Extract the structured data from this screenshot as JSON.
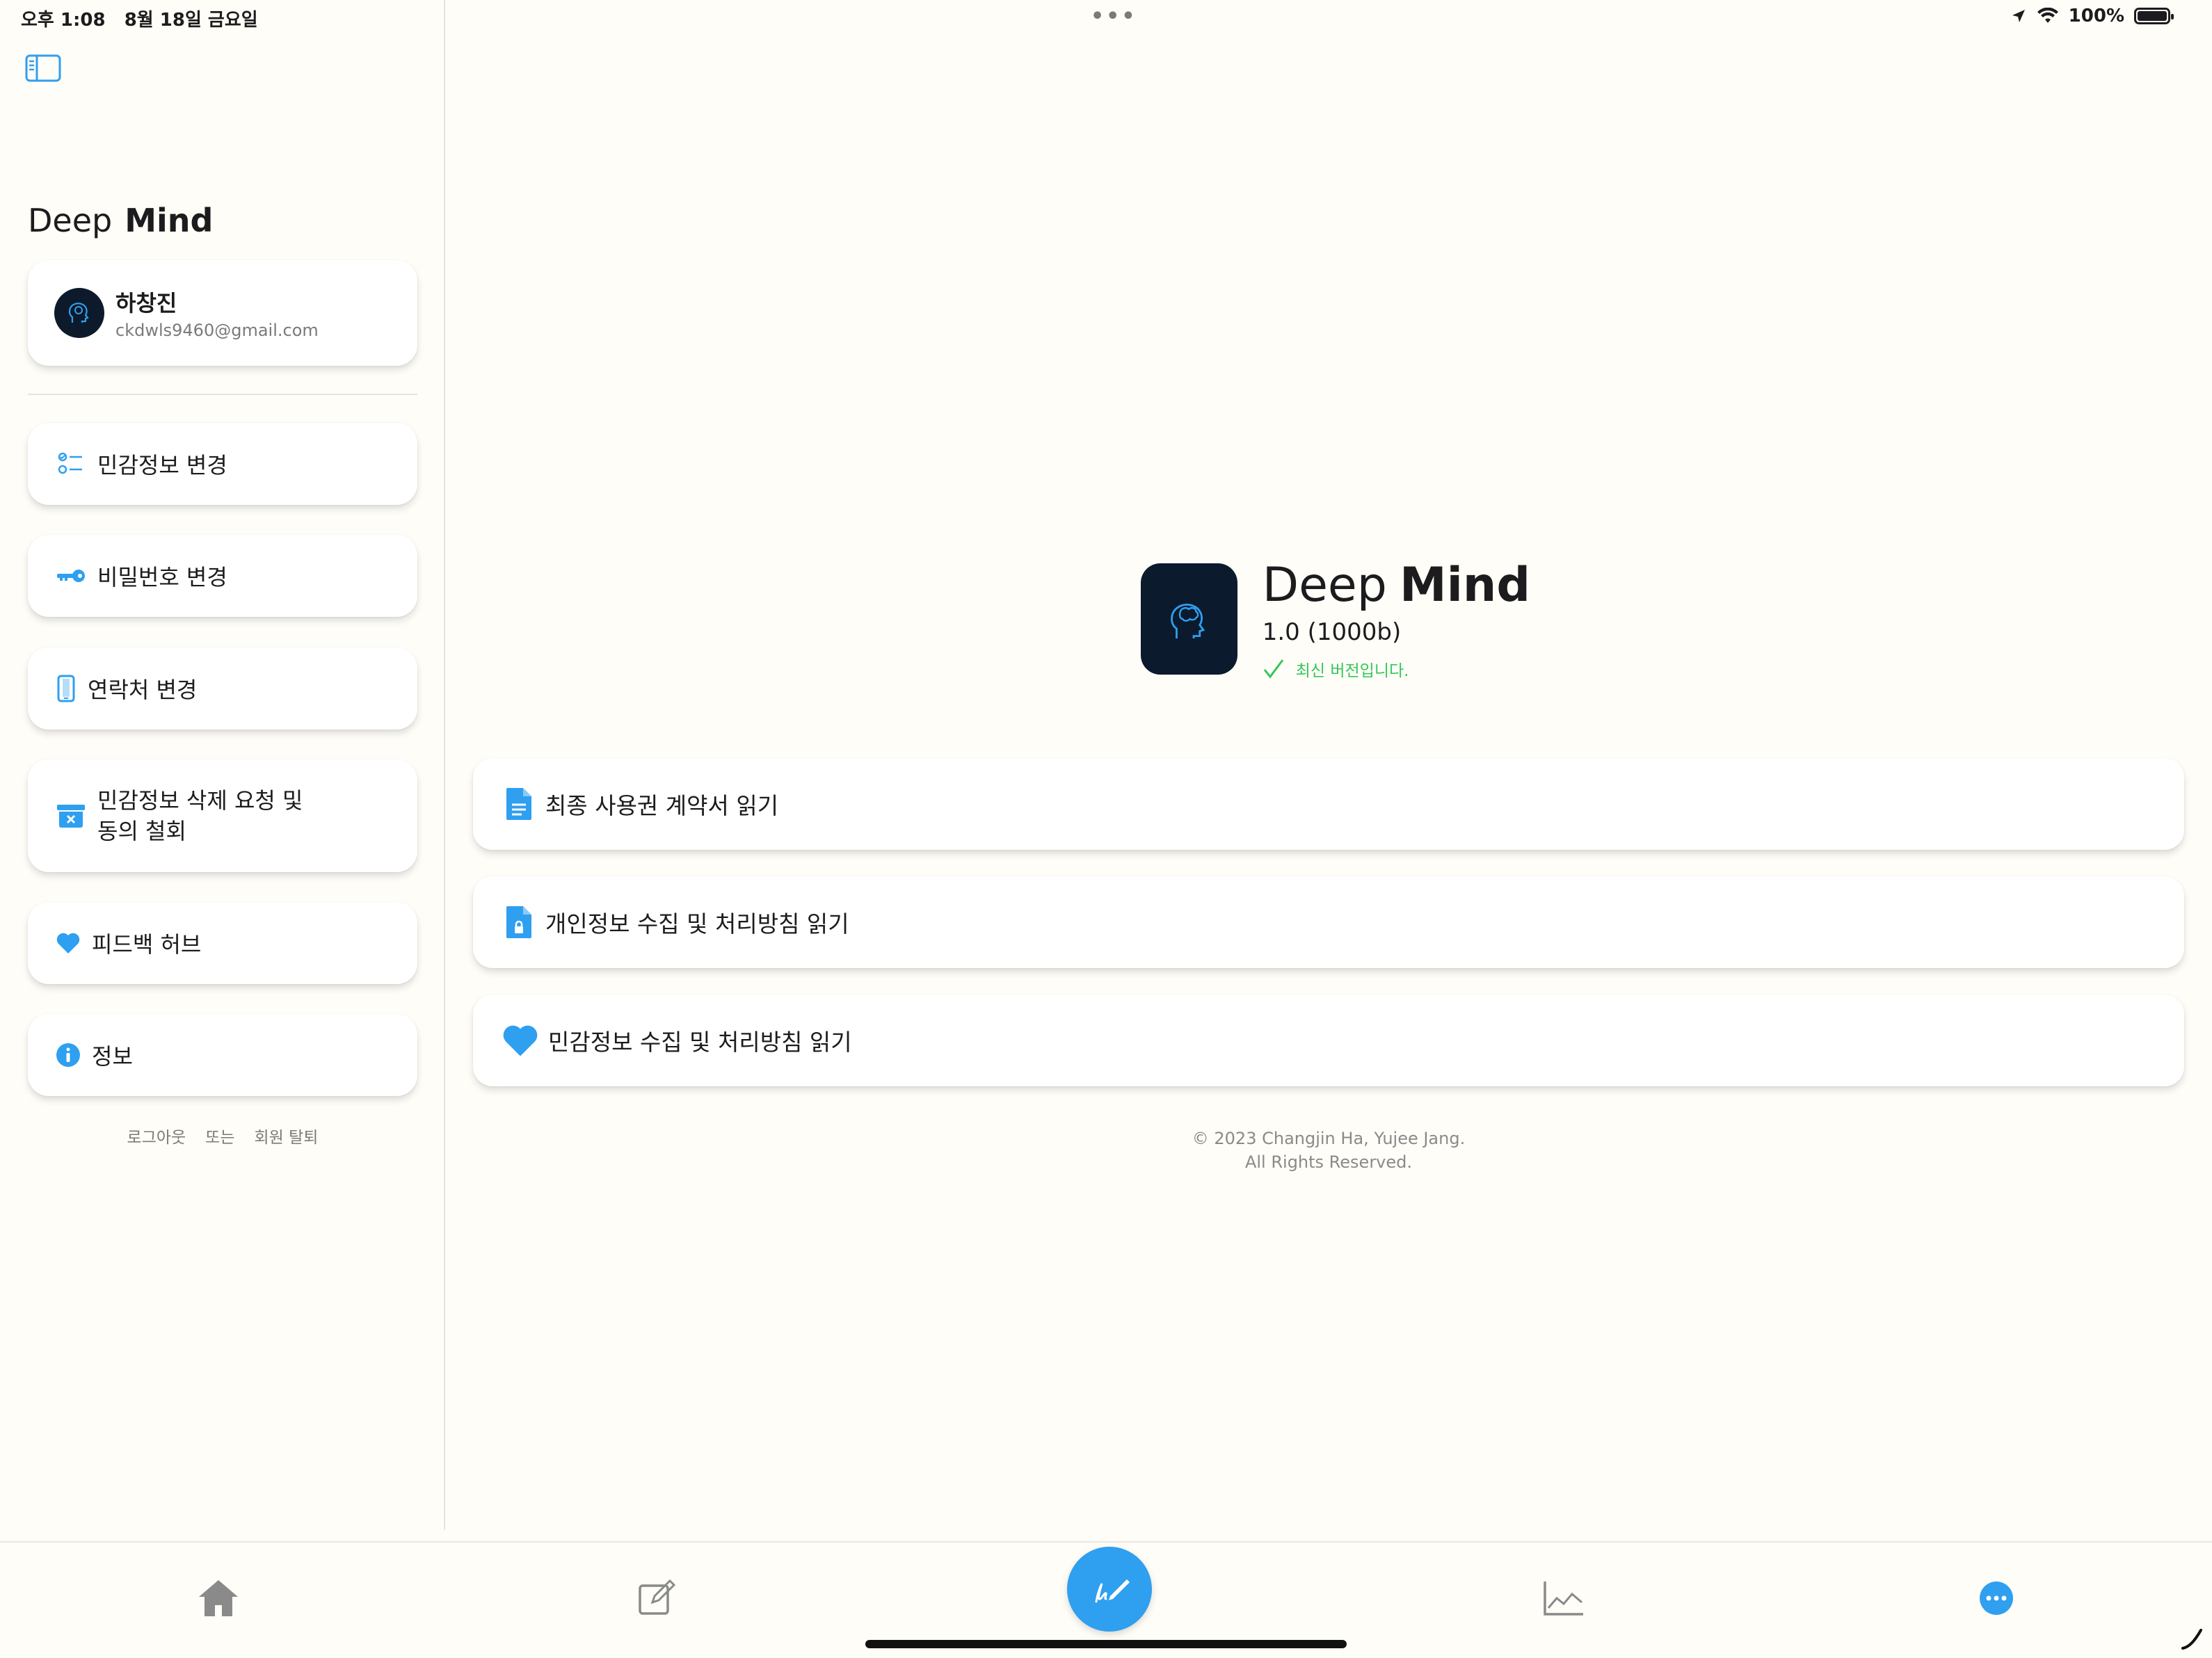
{
  "status_bar": {
    "time": "오후 1:08",
    "date": "8월 18일 금요일",
    "multitask_dots": "•••",
    "battery": "100%"
  },
  "sidebar": {
    "brand_deep": "Deep",
    "brand_mind": "Mind",
    "profile": {
      "name": "하창진",
      "email": "ckdwls9460@gmail.com"
    },
    "items": [
      {
        "label": "민감정보 변경",
        "icon": "checklist-icon"
      },
      {
        "label": "비밀번호 변경",
        "icon": "key-icon"
      },
      {
        "label": "연락처 변경",
        "icon": "phone-icon"
      },
      {
        "label_line1": "민감정보 삭제 요청 및",
        "label_line2": "동의 철회",
        "icon": "archive-x-icon"
      },
      {
        "label": "피드백 허브",
        "icon": "heart-icon"
      },
      {
        "label": "정보",
        "icon": "info-icon"
      }
    ],
    "footer": {
      "logout": "로그아웃",
      "or": "또는",
      "withdraw": "회원 탈퇴"
    }
  },
  "main": {
    "app_title_deep": "Deep",
    "app_title_mind": "Mind",
    "version": "1.0 (1000b)",
    "status": "최신 버전입니다.",
    "documents": [
      {
        "label": "최종 사용권 계약서 읽기",
        "icon": "document-icon"
      },
      {
        "label": "개인정보 수집 및 처리방침 읽기",
        "icon": "document-lock-icon"
      },
      {
        "label": "민감정보 수집 및 처리방침 읽기",
        "icon": "heart-icon"
      }
    ],
    "copyright_line1": "© 2023 Changjin Ha, Yujee Jang.",
    "copyright_line2": "All Rights Reserved."
  },
  "tabbar": {
    "tabs": [
      "home-icon",
      "compose-icon",
      "write-icon",
      "chart-icon",
      "more-icon"
    ],
    "selected": "more-icon"
  },
  "colors": {
    "accent": "#2f9ff0",
    "background": "#fffdf7",
    "success": "#34c759",
    "icon_dark_bg": "#0b1a2d"
  }
}
